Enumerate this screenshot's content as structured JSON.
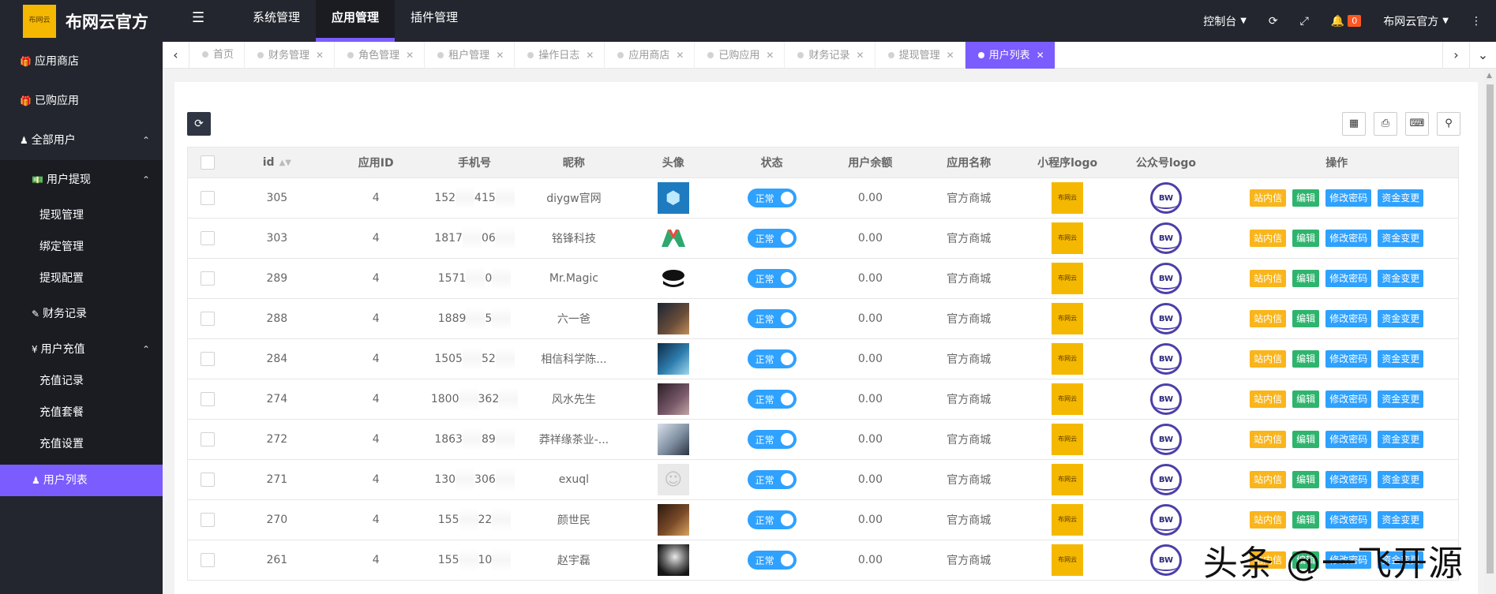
{
  "app": {
    "title": "布网云官方",
    "logo_text": "布网云"
  },
  "topnav": {
    "items": [
      "系统管理",
      "应用管理",
      "插件管理"
    ],
    "active_index": 1
  },
  "topright": {
    "console_label": "控制台",
    "notification_count": "0",
    "user_label": "布网云官方"
  },
  "sidebar": {
    "app_store": "应用商店",
    "purchased": "已购应用",
    "all_users": "全部用户",
    "withdraw_group": "用户提现",
    "withdraw_items": [
      "提现管理",
      "绑定管理",
      "提现配置"
    ],
    "finance": "财务记录",
    "recharge_group": "用户充值",
    "recharge_items": [
      "充值记录",
      "充值套餐",
      "充值设置"
    ],
    "user_list": "用户列表"
  },
  "tabs": [
    {
      "label": "首页",
      "closable": false
    },
    {
      "label": "财务管理",
      "closable": true
    },
    {
      "label": "角色管理",
      "closable": true
    },
    {
      "label": "租户管理",
      "closable": true
    },
    {
      "label": "操作日志",
      "closable": true
    },
    {
      "label": "应用商店",
      "closable": true
    },
    {
      "label": "已购应用",
      "closable": true
    },
    {
      "label": "财务记录",
      "closable": true
    },
    {
      "label": "提现管理",
      "closable": true
    },
    {
      "label": "用户列表",
      "closable": true,
      "active": true
    }
  ],
  "table": {
    "headers": {
      "id": "id",
      "app_id": "应用ID",
      "phone": "手机号",
      "nickname": "昵称",
      "avatar": "头像",
      "status": "状态",
      "balance": "用户余额",
      "app_name": "应用名称",
      "mini_logo": "小程序logo",
      "gzh_logo": "公众号logo",
      "ops": "操作"
    },
    "rows": [
      {
        "id": "305",
        "app_id": "4",
        "phone_a": "152",
        "phone_b": "415",
        "nickname": "diygw官网",
        "status": "正常",
        "balance": "0.00",
        "app_name": "官方商城"
      },
      {
        "id": "303",
        "app_id": "4",
        "phone_a": "1817",
        "phone_b": "06",
        "nickname": "铭锋科技",
        "status": "正常",
        "balance": "0.00",
        "app_name": "官方商城"
      },
      {
        "id": "289",
        "app_id": "4",
        "phone_a": "1571",
        "phone_b": "0",
        "nickname": "Mr.Magic",
        "status": "正常",
        "balance": "0.00",
        "app_name": "官方商城"
      },
      {
        "id": "288",
        "app_id": "4",
        "phone_a": "1889",
        "phone_b": "5",
        "nickname": "六一爸",
        "status": "正常",
        "balance": "0.00",
        "app_name": "官方商城"
      },
      {
        "id": "284",
        "app_id": "4",
        "phone_a": "1505",
        "phone_b": "52",
        "nickname": "相信科学陈...",
        "status": "正常",
        "balance": "0.00",
        "app_name": "官方商城"
      },
      {
        "id": "274",
        "app_id": "4",
        "phone_a": "1800",
        "phone_b": "362",
        "nickname": "风水先生",
        "status": "正常",
        "balance": "0.00",
        "app_name": "官方商城"
      },
      {
        "id": "272",
        "app_id": "4",
        "phone_a": "1863",
        "phone_b": "89",
        "nickname": "莽祥缘茶业-...",
        "status": "正常",
        "balance": "0.00",
        "app_name": "官方商城"
      },
      {
        "id": "271",
        "app_id": "4",
        "phone_a": "130",
        "phone_b": "306",
        "nickname": "exuql",
        "status": "正常",
        "balance": "0.00",
        "app_name": "官方商城"
      },
      {
        "id": "270",
        "app_id": "4",
        "phone_a": "155",
        "phone_b": "22",
        "nickname": "颜世民",
        "status": "正常",
        "balance": "0.00",
        "app_name": "官方商城"
      },
      {
        "id": "261",
        "app_id": "4",
        "phone_a": "155",
        "phone_b": "10",
        "nickname": "赵宇磊",
        "status": "正常",
        "balance": "0.00",
        "app_name": "官方商城"
      }
    ],
    "avatar_icons": [
      "cube-logo",
      "m-logo",
      "magic-logo",
      "night-photo",
      "blue-figure-photo",
      "portrait-photo",
      "man-photo",
      "default-avatar",
      "dark-photo",
      "planet-photo"
    ],
    "mini_logo_text": "布网云",
    "gzh_logo_text": "BW",
    "ops": {
      "message": "站内信",
      "edit": "编辑",
      "password": "修改密码",
      "fund": "资金变更"
    }
  },
  "watermark": "头条 @一飞开源",
  "colors": {
    "accent": "#7b5cff",
    "sidebar_bg": "#23262e",
    "switch_on": "#2fa1ff",
    "btn_warning": "#f9b51c",
    "btn_success": "#2fb46e",
    "btn_primary": "#2fa1ff"
  }
}
